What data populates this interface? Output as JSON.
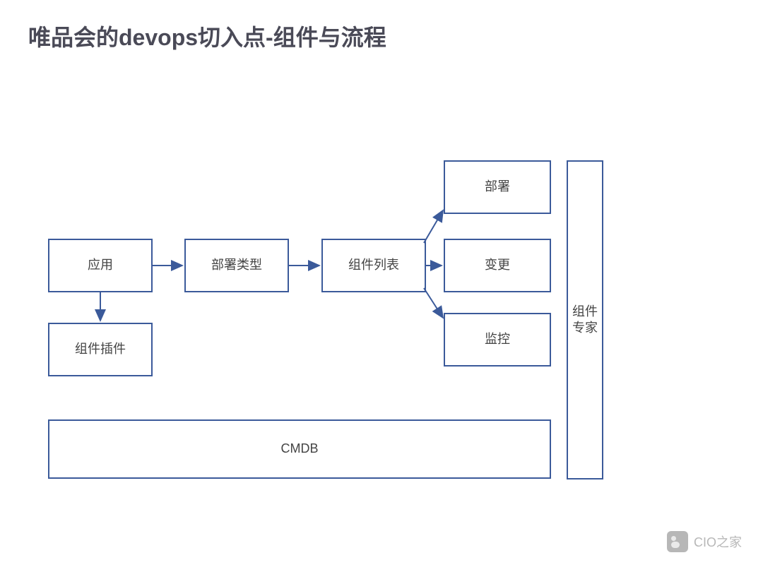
{
  "title": "唯品会的devops切入点-组件与流程",
  "boxes": {
    "app": "应用",
    "deployType": "部署类型",
    "componentList": "组件列表",
    "deploy": "部署",
    "change": "变更",
    "monitor": "监控",
    "plugin": "组件插件",
    "cmdb": "CMDB",
    "expert": "组件\n专家"
  },
  "watermark": "CIO之家",
  "colors": {
    "border": "#3b5a9a",
    "title": "#4a4a57",
    "text": "#444"
  }
}
